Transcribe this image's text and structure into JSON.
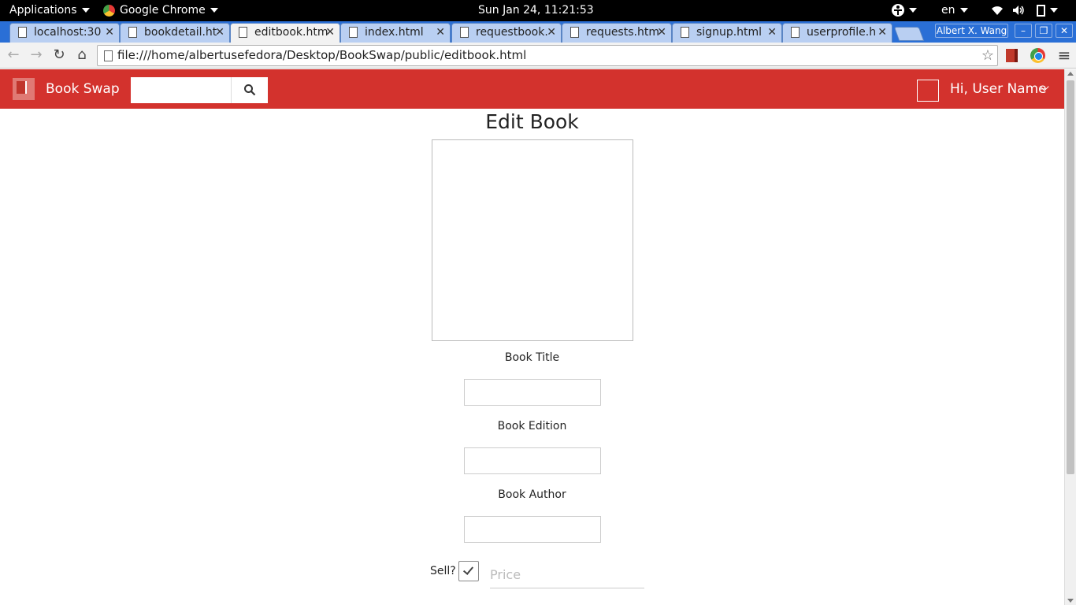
{
  "system_bar": {
    "applications": "Applications",
    "app_name": "Google Chrome",
    "clock": "Sun Jan 24, 11:21:53",
    "language": "en"
  },
  "browser": {
    "tabs": [
      {
        "label": "localhost:30",
        "active": false
      },
      {
        "label": "bookdetail.ht",
        "active": false
      },
      {
        "label": "editbook.htm",
        "active": true
      },
      {
        "label": "index.html",
        "active": false
      },
      {
        "label": "requestbook.",
        "active": false
      },
      {
        "label": "requests.htm",
        "active": false
      },
      {
        "label": "signup.html",
        "active": false
      },
      {
        "label": "userprofile.h",
        "active": false
      }
    ],
    "profile_name": "Albert X. Wang",
    "url": "file:///home/albertusefedora/Desktop/BookSwap/public/editbook.html"
  },
  "app_header": {
    "brand": "Book Swap",
    "greeting": "Hi, User Name",
    "accent_color": "#d3322d"
  },
  "form": {
    "title": "Edit Book",
    "title_label": "Book Title",
    "edition_label": "Book Edition",
    "author_label": "Book Author",
    "sell_label": "Sell?",
    "sell_checked": true,
    "price_placeholder": "Price"
  }
}
